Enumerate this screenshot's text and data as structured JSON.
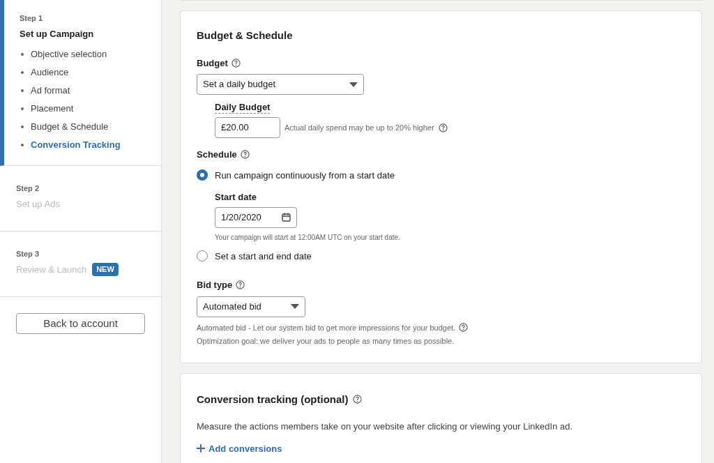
{
  "sidebar": {
    "steps": [
      {
        "label": "Step 1",
        "title": "Set up Campaign",
        "active": true,
        "items": [
          {
            "label": "Objective selection",
            "selected": false
          },
          {
            "label": "Audience",
            "selected": false
          },
          {
            "label": "Ad format",
            "selected": false
          },
          {
            "label": "Placement",
            "selected": false
          },
          {
            "label": "Budget & Schedule",
            "selected": false
          },
          {
            "label": "Conversion Tracking",
            "selected": true
          }
        ]
      },
      {
        "label": "Step 2",
        "title": "Set up Ads",
        "active": false
      },
      {
        "label": "Step 3",
        "title": "Review & Launch",
        "active": false,
        "badge": "NEW"
      }
    ],
    "back_button": "Back to account"
  },
  "budget_schedule": {
    "title": "Budget & Schedule",
    "budget": {
      "label": "Budget",
      "value": "Set a daily budget"
    },
    "daily_budget": {
      "label": "Daily Budget",
      "value": "£20.00",
      "hint": "Actual daily spend may be up to 20% higher"
    },
    "schedule": {
      "label": "Schedule",
      "options": [
        {
          "label": "Run campaign continuously from a start date",
          "selected": true,
          "start_date": {
            "label": "Start date",
            "value": "1/20/2020",
            "note": "Your campaign will start at 12:00AM UTC on your start date."
          }
        },
        {
          "label": "Set a start and end date",
          "selected": false
        }
      ]
    },
    "bid_type": {
      "label": "Bid type",
      "value": "Automated bid",
      "descriptions": [
        "Automated bid - Let our system bid to get more impressions for your budget.",
        "Optimization goal: we deliver your ads to people as many times as possible."
      ]
    }
  },
  "conversion_tracking": {
    "title": "Conversion tracking (optional)",
    "description": "Measure the actions members take on your website after clicking or viewing your LinkedIn ad.",
    "link": "Add conversions"
  }
}
